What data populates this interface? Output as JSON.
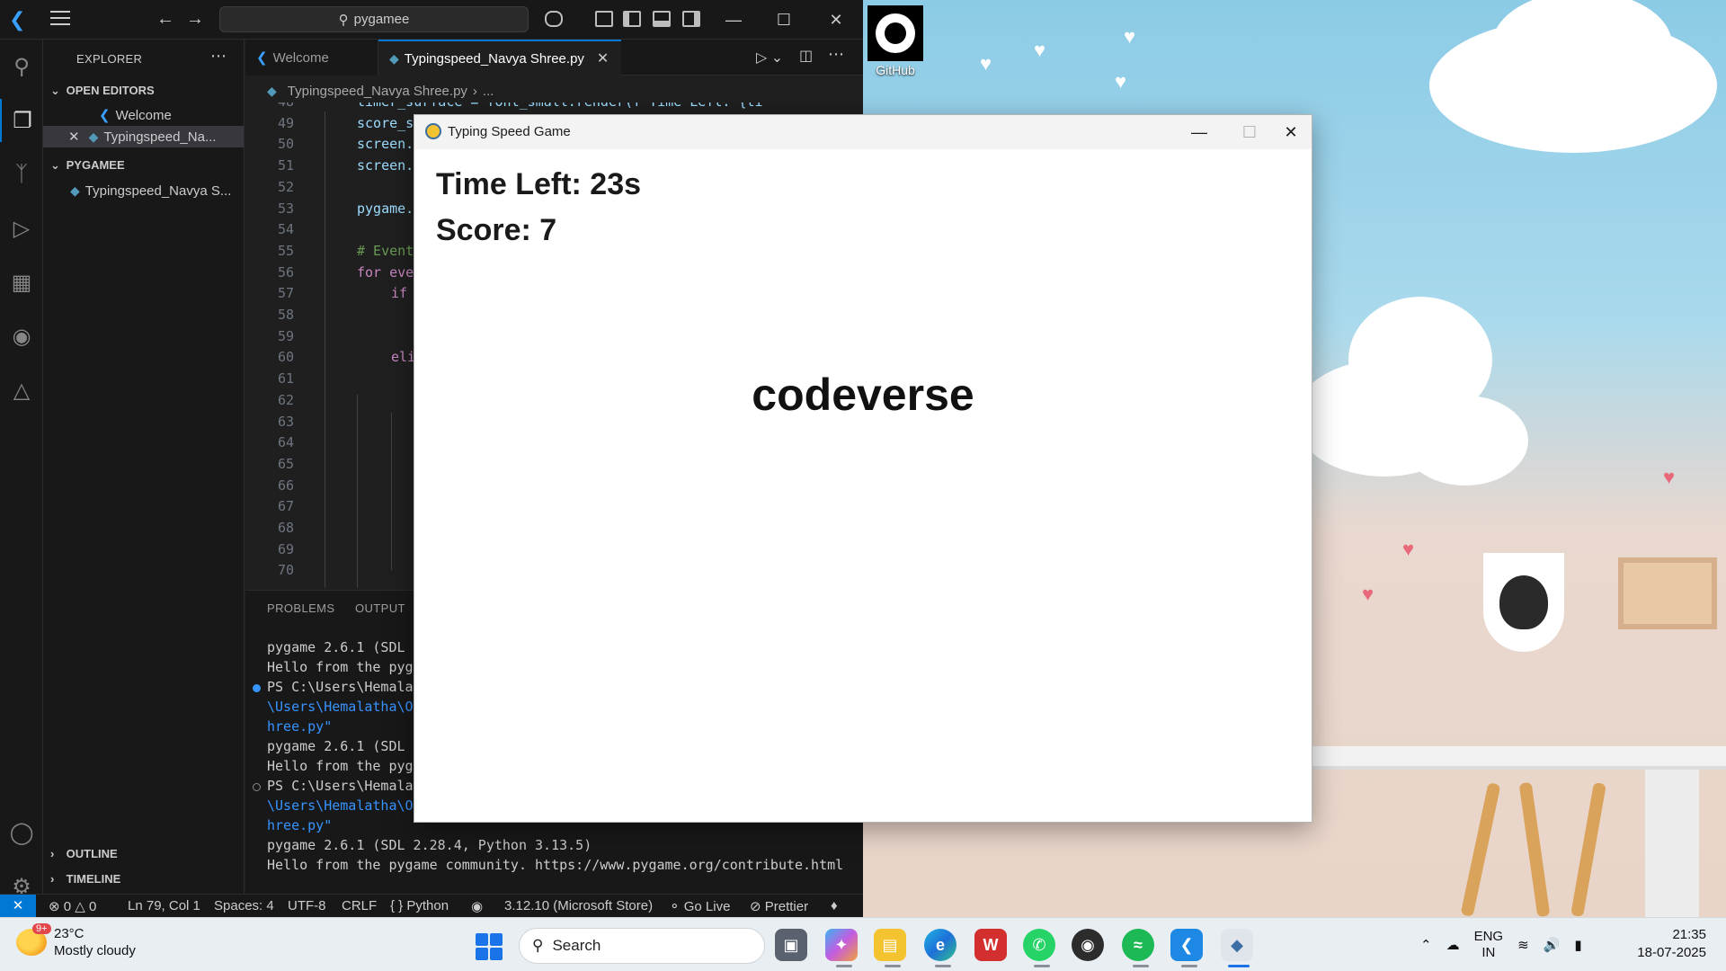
{
  "desktop": {
    "github_label": "GitHub"
  },
  "vscode": {
    "search_text": "pygamee",
    "sidebar": {
      "title": "EXPLORER",
      "open_editors_header": "OPEN EDITORS",
      "open_editors": [
        "Welcome",
        "Typingspeed_Na..."
      ],
      "folder_header": "PYGAMEE",
      "folder_items": [
        "Typingspeed_Navya S..."
      ],
      "outline": "OUTLINE",
      "timeline": "TIMELINE"
    },
    "tabs": [
      {
        "label": "Welcome",
        "active": false
      },
      {
        "label": "Typingspeed_Navya Shree.py",
        "active": true
      }
    ],
    "breadcrumb": [
      "Typingspeed_Navya Shree.py",
      "..."
    ],
    "code_lines": [
      {
        "n": "48",
        "text": "timer_surface = font_small.render(f\"Time Left: {ti"
      },
      {
        "n": "49",
        "text": "score_s"
      },
      {
        "n": "50",
        "text": "screen."
      },
      {
        "n": "51",
        "text": "screen."
      },
      {
        "n": "52",
        "text": ""
      },
      {
        "n": "53",
        "text": "pygame."
      },
      {
        "n": "54",
        "text": ""
      },
      {
        "n": "55",
        "text": "# Event"
      },
      {
        "n": "56",
        "text": "for eve"
      },
      {
        "n": "57",
        "text": "if"
      },
      {
        "n": "58",
        "text": ""
      },
      {
        "n": "59",
        "text": ""
      },
      {
        "n": "60",
        "text": "eli"
      },
      {
        "n": "61",
        "text": ""
      },
      {
        "n": "62",
        "text": ""
      },
      {
        "n": "63",
        "text": ""
      },
      {
        "n": "64",
        "text": ""
      },
      {
        "n": "65",
        "text": ""
      },
      {
        "n": "66",
        "text": ""
      },
      {
        "n": "67",
        "text": ""
      },
      {
        "n": "68",
        "text": ""
      },
      {
        "n": "69",
        "text": ""
      },
      {
        "n": "70",
        "text": ""
      }
    ],
    "panel": {
      "tabs": [
        "PROBLEMS",
        "OUTPUT"
      ],
      "terminal_lines": [
        "pygame 2.6.1 (SDL",
        "Hello from the pyg",
        "PS C:\\Users\\Hemala",
        "\\Users\\Hemalatha\\O",
        "hree.py\"",
        "pygame 2.6.1 (SDL",
        "Hello from the pyg",
        "PS C:\\Users\\Hemala",
        "\\Users\\Hemalatha\\O",
        "hree.py\"",
        "pygame 2.6.1 (SDL 2.28.4, Python 3.13.5)",
        "Hello from the pygame community. https://www.pygame.org/contribute.html"
      ]
    },
    "status": {
      "errors": "0",
      "warnings": "0",
      "position": "Ln 79, Col 1",
      "spaces": "Spaces: 4",
      "encoding": "UTF-8",
      "eol": "CRLF",
      "language": "Python",
      "interpreter": "3.12.10 (Microsoft Store)",
      "golive": "Go Live",
      "prettier": "Prettier"
    }
  },
  "game": {
    "title": "Typing Speed Game",
    "time_left": "Time Left: 23s",
    "score": "Score: 7",
    "word": "codeverse"
  },
  "taskbar": {
    "weather_temp": "23°C",
    "weather_desc": "Mostly cloudy",
    "weather_badge": "9+",
    "search_label": "Search",
    "language": "ENG",
    "region": "IN",
    "time": "21:35",
    "date": "18-07-2025"
  },
  "colors": {
    "vscode_accent": "#0078d4",
    "game_bg": "#ffffff"
  }
}
